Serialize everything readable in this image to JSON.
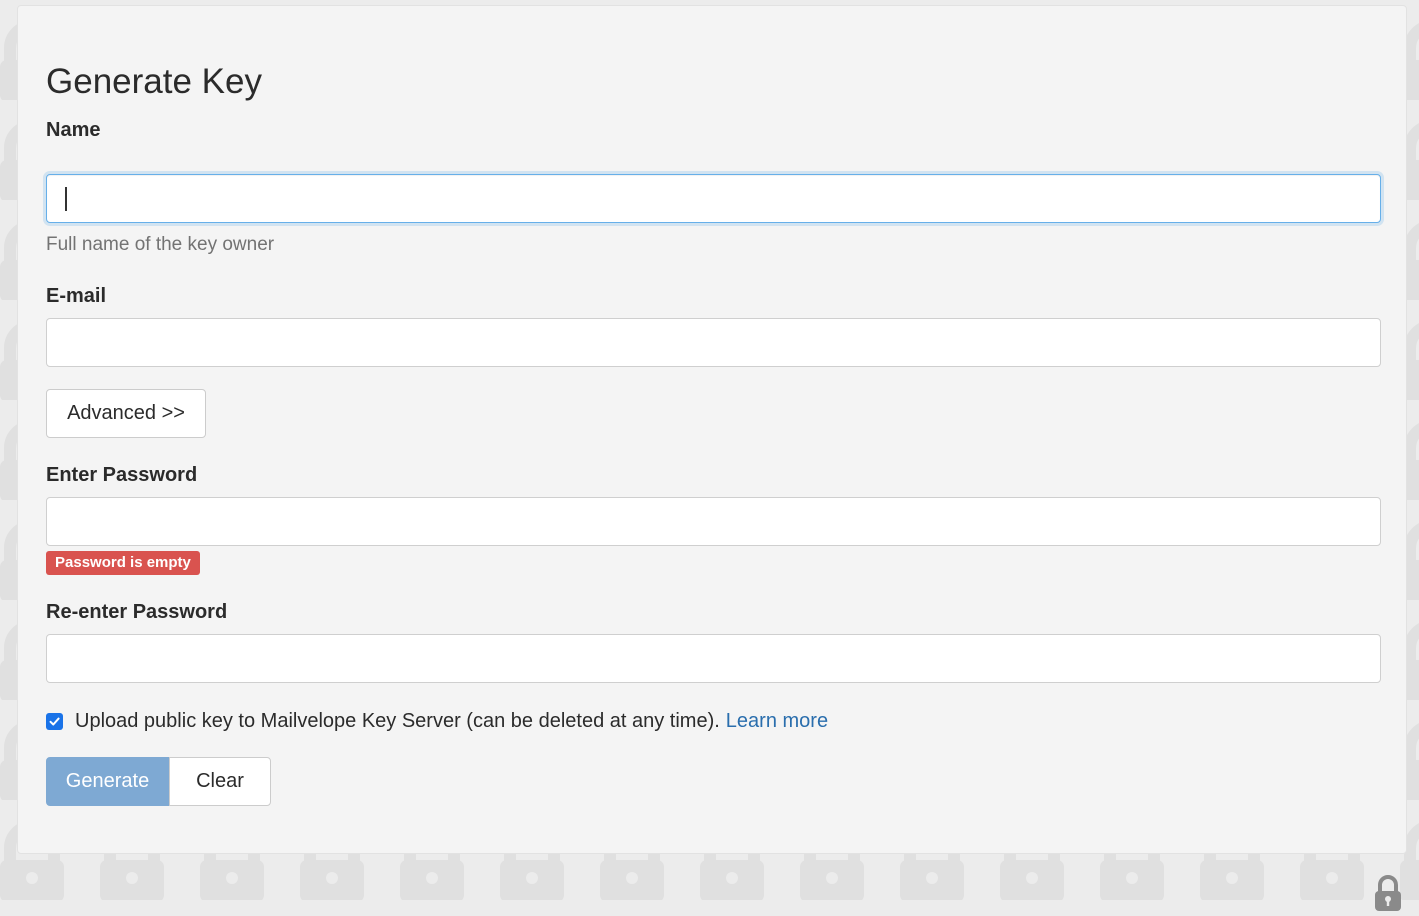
{
  "form": {
    "title": "Generate Key",
    "name": {
      "label": "Name",
      "value": "",
      "help": "Full name of the key owner"
    },
    "email": {
      "label": "E-mail",
      "value": ""
    },
    "advanced_button": "Advanced >>",
    "password": {
      "label": "Enter Password",
      "value": "",
      "error": "Password is empty"
    },
    "password_confirm": {
      "label": "Re-enter Password",
      "value": ""
    },
    "upload": {
      "checked": true,
      "text": "Upload public key to Mailvelope Key Server (can be deleted at any time).",
      "link": "Learn more"
    },
    "generate_button": "Generate",
    "clear_button": "Clear"
  },
  "colors": {
    "accent": "#66afe9",
    "primary_disabled": "#7ea9d3",
    "error": "#d9534f",
    "link": "#2a6ead"
  },
  "icons": {
    "background": "padlock-icon",
    "corner": "padlock-icon"
  }
}
